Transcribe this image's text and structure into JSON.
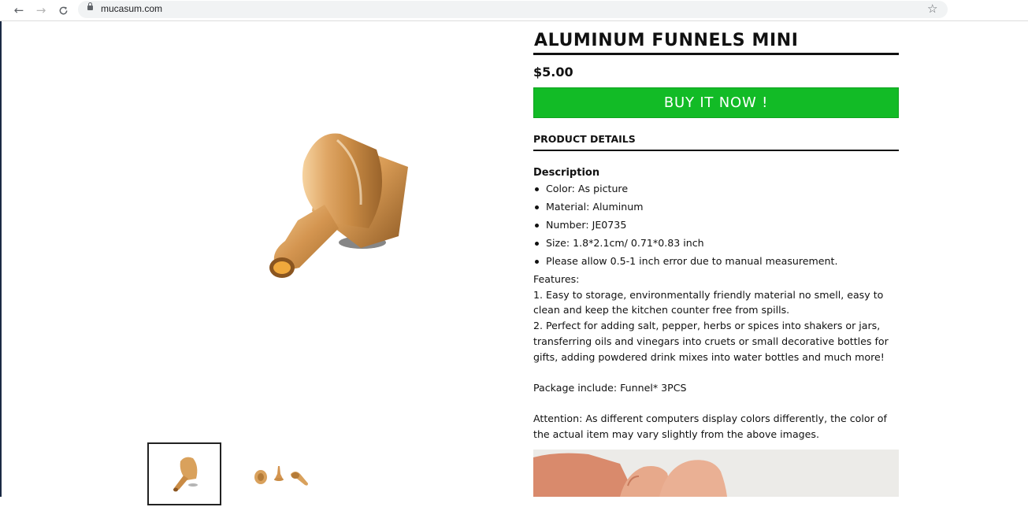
{
  "browser": {
    "url": "mucasum.com"
  },
  "product": {
    "title": "ALUMINUM FUNNELS MINI",
    "price": "$5.00",
    "buy_label": "BUY IT NOW !",
    "details_heading": "PRODUCT DETAILS",
    "description_heading": "Description",
    "specs": [
      "Color: As picture",
      "Material: Aluminum",
      "Number: JE0735",
      "Size: 1.8*2.1cm/ 0.71*0.83 inch",
      "Please allow 0.5-1 inch error due to manual measurement."
    ],
    "features_heading": "Features:",
    "feature_1": "1. Easy to storage, environmentally friendly material no smell, easy to clean and keep the kitchen counter free from spills.",
    "feature_2": "2. Perfect for adding salt, pepper, herbs or spices into shakers or jars, transferring oils and vinegars into cruets or small decorative bottles for gifts, adding powdered drink mixes into water bottles and much more!",
    "package": "Package include: Funnel* 3PCS",
    "attention": "Attention: As different computers display colors differently, the color of the actual item may vary slightly from the above images."
  },
  "colors": {
    "buy_button": "#12bb26",
    "funnel_gold": "#d9a15c"
  },
  "icons": [
    "back-arrow-icon",
    "forward-arrow-icon",
    "reload-icon",
    "lock-icon",
    "star-icon"
  ]
}
